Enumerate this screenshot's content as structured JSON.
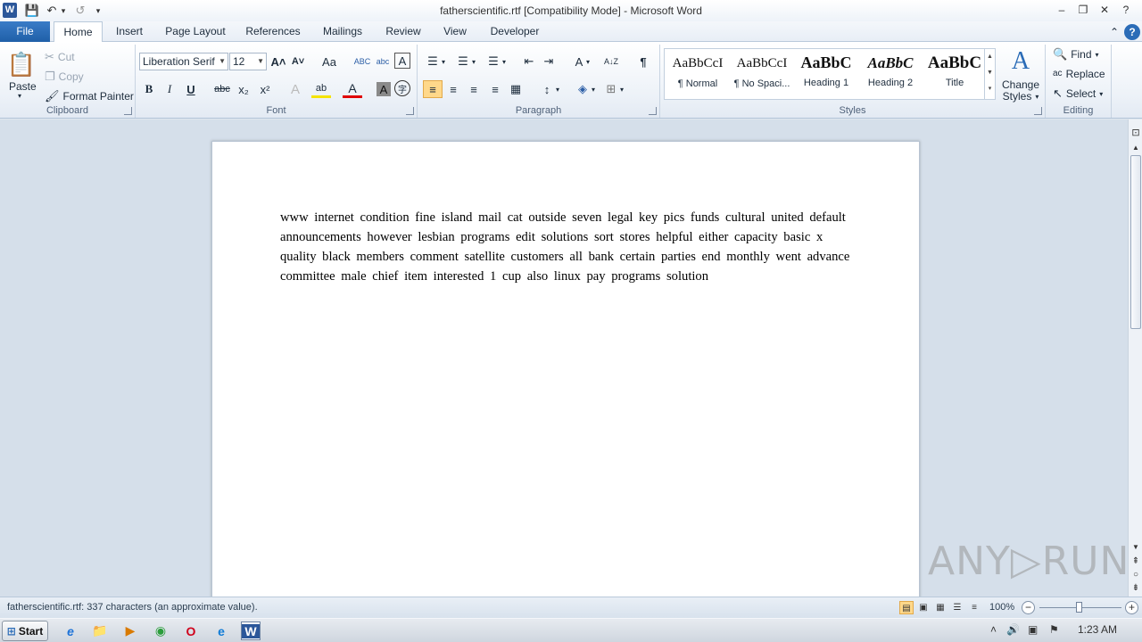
{
  "titlebar": {
    "title": "fatherscientific.rtf [Compatibility Mode]  -  Microsoft Word",
    "app_icon": "W",
    "qat": {
      "save": "💾",
      "undo": "↶",
      "undo_arrow": "▾",
      "redo": "↺",
      "customize": "▾"
    },
    "win": {
      "help": "?",
      "minimize": "–",
      "restore": "❐",
      "close": "✕"
    }
  },
  "tabs": [
    {
      "label": "File"
    },
    {
      "label": "Home"
    },
    {
      "label": "Insert"
    },
    {
      "label": "Page Layout"
    },
    {
      "label": "References"
    },
    {
      "label": "Mailings"
    },
    {
      "label": "Review"
    },
    {
      "label": "View"
    },
    {
      "label": "Developer"
    }
  ],
  "ribbon_help": {
    "collapse": "⌃",
    "help": "?"
  },
  "clipboard": {
    "label": "Clipboard",
    "paste": "Paste",
    "paste_arrow": "▾",
    "cut": "Cut",
    "copy": "Copy",
    "format_painter": "Format Painter",
    "icons": {
      "paste": "📋",
      "cut": "✂",
      "copy": "❐",
      "format_painter": "🖌"
    }
  },
  "font": {
    "label": "Font",
    "font_name": "Liberation Serif",
    "font_size": "12",
    "grow": "A˄",
    "shrink": "A˅",
    "change_case": "Aa",
    "clear": "A",
    "bold": "B",
    "italic": "I",
    "underline": "U",
    "strike": "abc",
    "subscript": "x₂",
    "superscript": "x²",
    "text_effects": "A",
    "highlight": "ab",
    "font_color": "A",
    "shading": "A",
    "enclose": "字",
    "spell": "ABC",
    "phonetic": "abc"
  },
  "paragraph": {
    "label": "Paragraph",
    "bullets": "☰",
    "numbering": "☰",
    "multilevel": "☰",
    "dec_indent": "⇤",
    "inc_indent": "⇥",
    "chinese_layout": "A",
    "sort": "A↓Z",
    "show_marks": "¶",
    "align_left": "≡",
    "align_center": "≡",
    "align_right": "≡",
    "justify": "≡",
    "distributed": "▦",
    "line_spacing": "↕",
    "shading": "◈",
    "borders": "⊞",
    "arrow": "▾"
  },
  "styles": {
    "label": "Styles",
    "tiles": [
      {
        "sample": "AaBbCcI",
        "name": "¶ Normal"
      },
      {
        "sample": "AaBbCcI",
        "name": "¶ No Spaci..."
      },
      {
        "sample": "AaBbC",
        "name": "Heading 1"
      },
      {
        "sample": "AaBbC",
        "name": "Heading 2"
      },
      {
        "sample": "AaBbC",
        "name": "Title"
      }
    ],
    "scroll_up": "▲",
    "scroll_down": "▼",
    "more": "▾",
    "change_styles_line1": "Change",
    "change_styles_line2": "Styles",
    "change_styles_icon": "A",
    "change_styles_arrow": "▾"
  },
  "editing": {
    "label": "Editing",
    "find": "Find",
    "replace": "Replace",
    "select": "Select",
    "arrow": "▾",
    "icons": {
      "find": "🔍",
      "replace": "ac",
      "select": "↖"
    }
  },
  "document": {
    "text": "www internet condition fine island mail cat outside seven legal key pics funds cultural united default announcements however lesbian programs edit solutions sort stores helpful either capacity basic x quality black members comment satellite customers all bank certain parties end monthly went advance committee male chief item interested 1 cup also linux pay programs solution"
  },
  "vscroll": {
    "ruler": "⊡",
    "up": "▲",
    "down": "▼",
    "prev_page": "⇞",
    "select_browse": "○",
    "next_page": "⇟"
  },
  "watermark": "ANY▷RUN",
  "statusbar": {
    "text": "fatherscientific.rtf: 337 characters (an approximate value).",
    "zoom": "100%",
    "zoom_out": "−",
    "zoom_in": "+",
    "views": {
      "print": "▤",
      "full_screen": "▣",
      "web": "▦",
      "outline": "☰",
      "draft": "≡"
    }
  },
  "taskbar": {
    "start": "Start",
    "start_icon": "⊞",
    "apps": [
      "e",
      "📁",
      "▶",
      "◉",
      "O",
      "e",
      "W"
    ],
    "tray": {
      "arrow": "˄",
      "volume": "🔊",
      "network": "▣",
      "flag": "⚑"
    },
    "clock": "1:23 AM"
  }
}
